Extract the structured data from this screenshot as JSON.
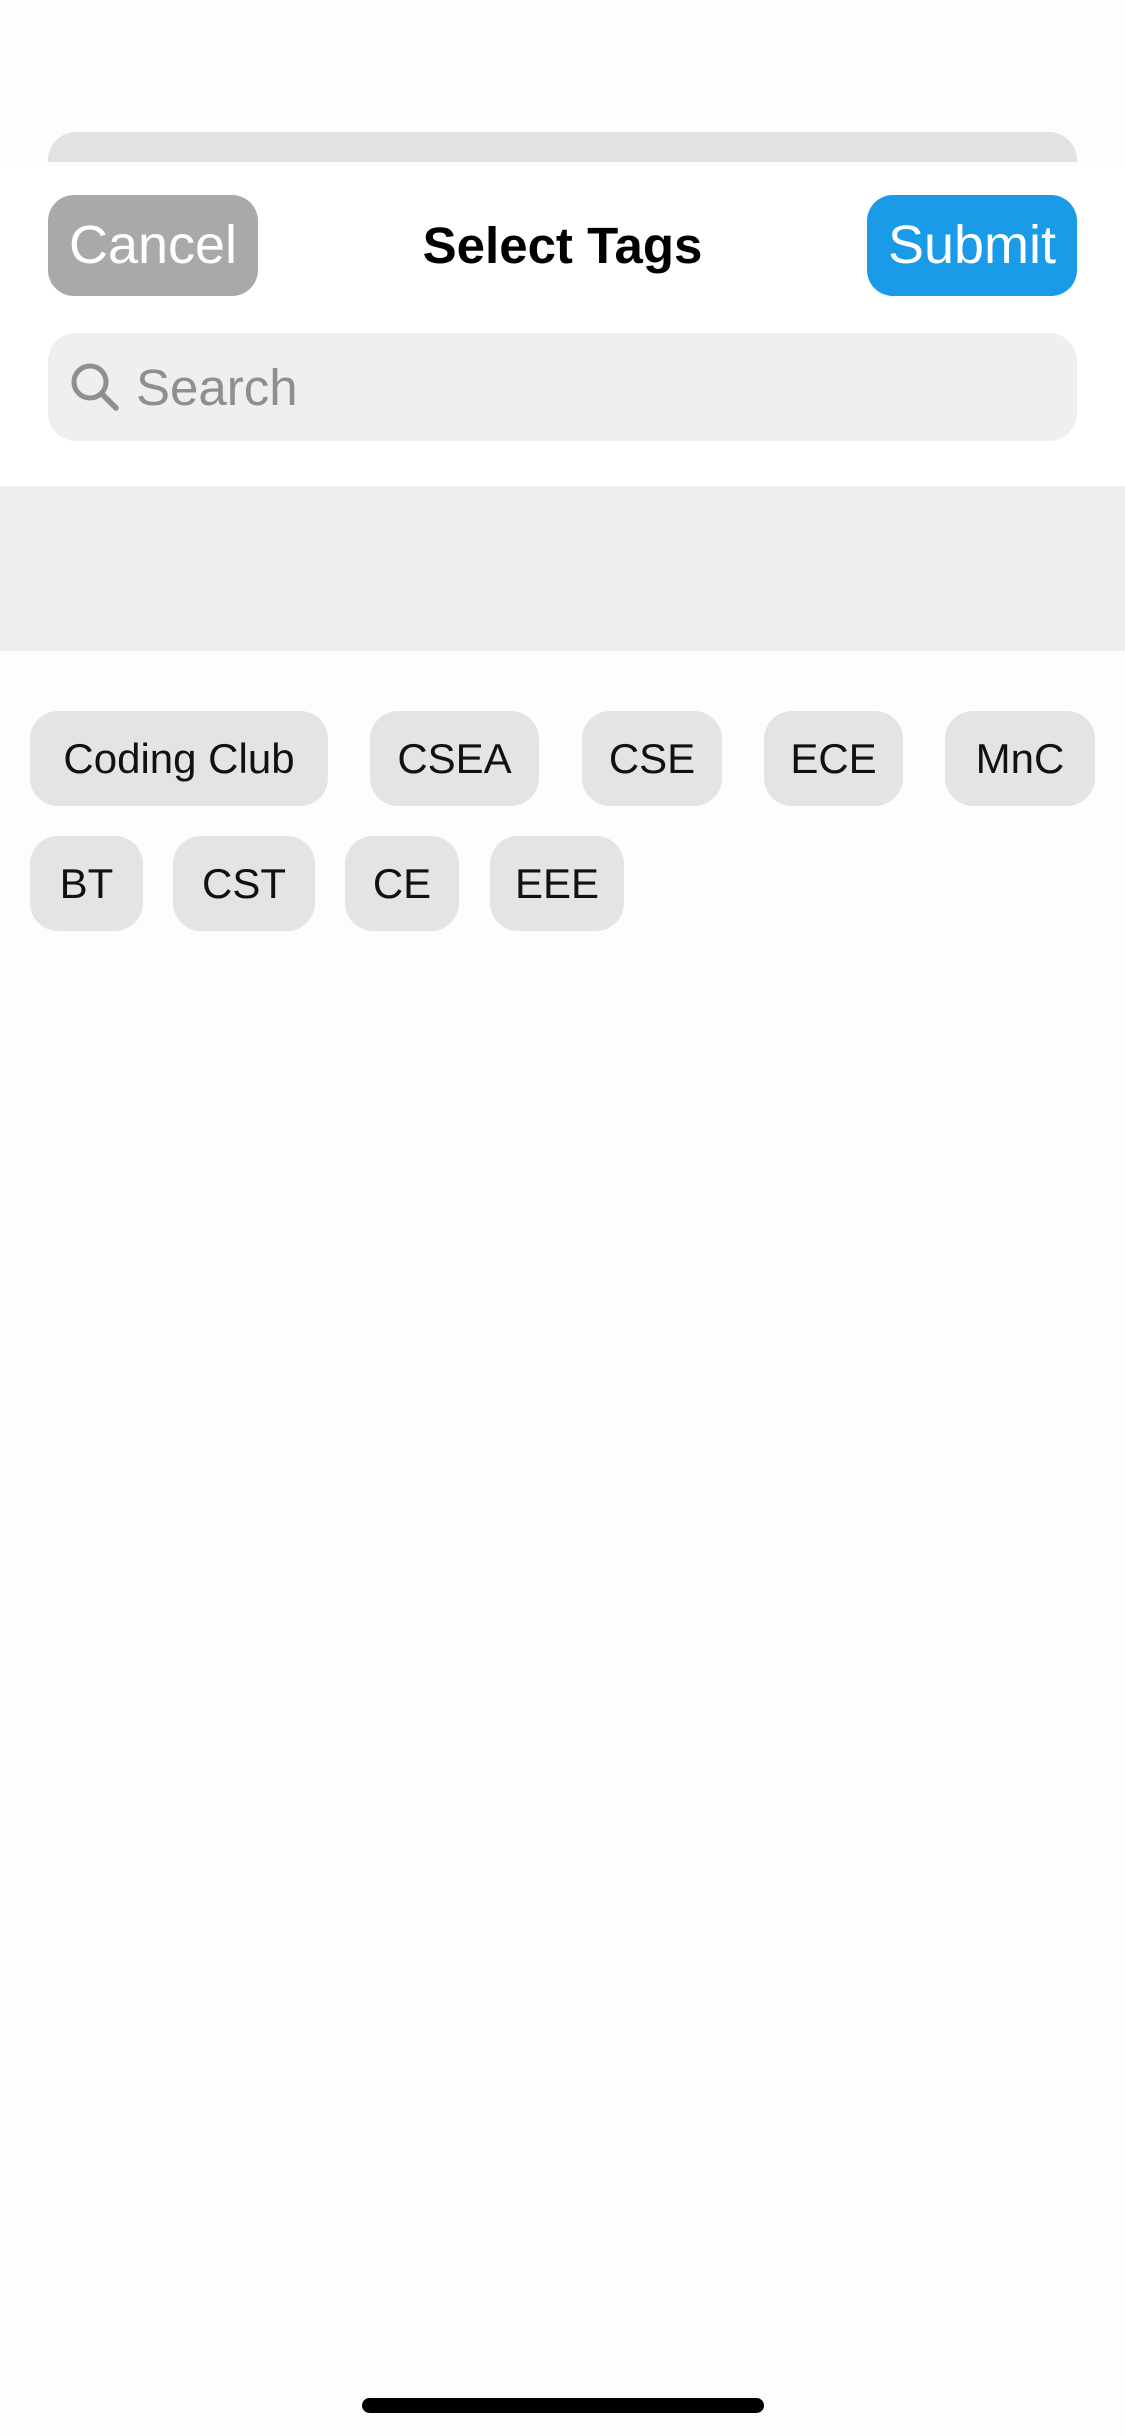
{
  "header": {
    "cancel_label": "Cancel",
    "title": "Select Tags",
    "submit_label": "Submit"
  },
  "search": {
    "placeholder": "Search",
    "value": "",
    "icon": "search-icon"
  },
  "selected_tags": [],
  "tags": [
    "Coding Club",
    "CSEA",
    "CSE",
    "ECE",
    "MnC",
    "BT",
    "CST",
    "CE",
    "EEE"
  ],
  "colors": {
    "cancel_bg": "#A9A9A9",
    "submit_bg": "#1A9BE8",
    "tag_bg": "#E4E4E4",
    "search_bg": "#EFEFEF",
    "selected_area_bg": "#EEEEEE"
  }
}
